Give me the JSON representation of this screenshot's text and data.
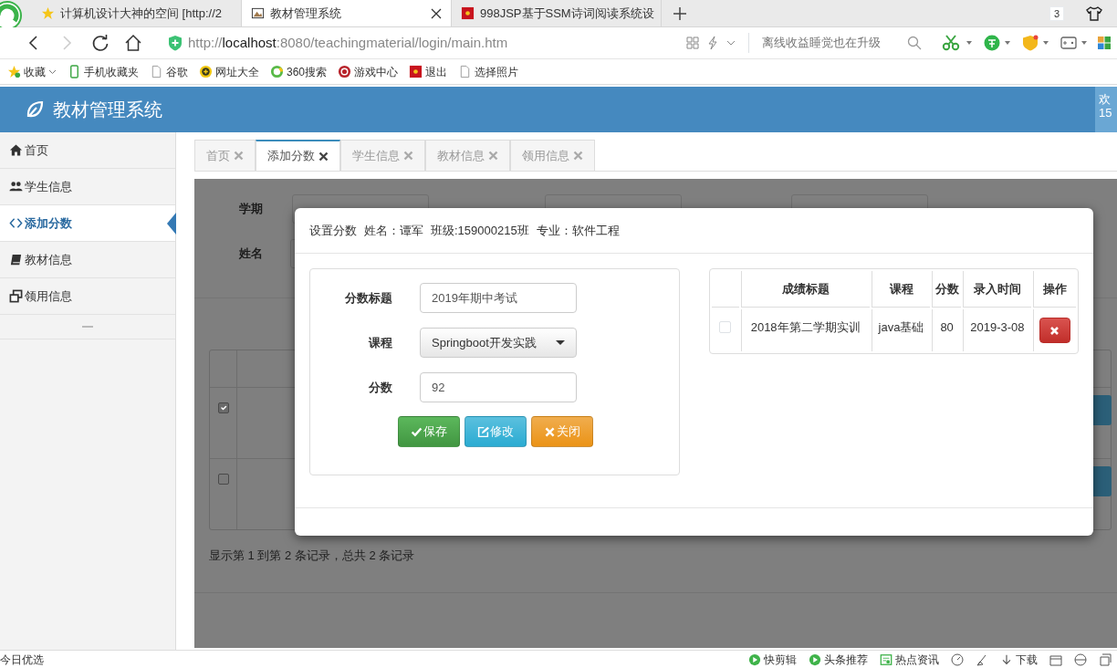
{
  "browser": {
    "tabs": [
      {
        "title": "计算机设计大神的空间 [http://2",
        "kind": "favorite",
        "selected": false
      },
      {
        "title": "教材管理系统",
        "kind": "app",
        "selected": true
      },
      {
        "title": "998JSP基于SSM诗词阅读系统设",
        "kind": "site",
        "selected": false
      }
    ],
    "tab_count": "3",
    "address": {
      "scheme": "http://",
      "host": "localhost",
      "path": ":8080/teachingmaterial/login/main.htm"
    },
    "search": {
      "placeholder": "离线收益睡觉也在升级"
    },
    "bookmarks": [
      {
        "label": "收藏",
        "kind": "favorites"
      },
      {
        "label": "手机收藏夹",
        "kind": "phone"
      },
      {
        "label": "谷歌",
        "kind": "page"
      },
      {
        "label": "网址大全",
        "kind": "portal"
      },
      {
        "label": "360搜索",
        "kind": "ring"
      },
      {
        "label": "游戏中心",
        "kind": "game"
      },
      {
        "label": "退出",
        "kind": "site"
      },
      {
        "label": "选择照片",
        "kind": "page"
      }
    ],
    "status_bar": {
      "left": "今日优选",
      "items": [
        {
          "label": "快剪辑",
          "kind": "play"
        },
        {
          "label": "头条推荐",
          "kind": "play"
        },
        {
          "label": "热点资讯",
          "kind": "news"
        },
        {
          "label": "下载",
          "kind": "download"
        }
      ]
    }
  },
  "app": {
    "title": "教材管理系统",
    "user": {
      "line_1": "欢",
      "line_2": "15"
    }
  },
  "sidebar": {
    "items": [
      {
        "label": "首页",
        "kind": "home",
        "selected": false
      },
      {
        "label": "学生信息",
        "kind": "users",
        "selected": false
      },
      {
        "label": "添加分数",
        "kind": "code",
        "selected": true
      },
      {
        "label": "教材信息",
        "kind": "book",
        "selected": false
      },
      {
        "label": "领用信息",
        "kind": "clone",
        "selected": false
      }
    ]
  },
  "tabs": [
    {
      "label": "首页",
      "selected": false
    },
    {
      "label": "添加分数",
      "selected": true
    },
    {
      "label": "学生信息",
      "selected": false
    },
    {
      "label": "教材信息",
      "selected": false
    },
    {
      "label": "领用信息",
      "selected": false
    }
  ],
  "filters": {
    "row_1": [
      "学期"
    ],
    "row_2": [
      "姓名"
    ]
  },
  "table": {
    "rows": [
      {
        "checked": true
      },
      {
        "checked": false
      }
    ]
  },
  "pagination": "显示第 1 到第 2 条记录，总共 2 条记录",
  "modal": {
    "title": "设置分数",
    "student": "姓名：谭军",
    "class": "班级:159000215班",
    "major": "专业：软件工程",
    "fields": [
      {
        "label": "分数标题",
        "value": "2019年期中考试",
        "kind": "text"
      },
      {
        "label": "课程",
        "value": "Springboot开发实践",
        "kind": "select"
      },
      {
        "label": "分数",
        "value": "92",
        "kind": "text"
      }
    ],
    "buttons": [
      {
        "label": "保存",
        "kind": "success"
      },
      {
        "label": "修改",
        "kind": "info"
      },
      {
        "label": "关闭",
        "kind": "warning"
      }
    ],
    "scores": {
      "columns": [
        "成绩标题",
        "课程",
        "分数",
        "录入时间",
        "操作"
      ],
      "rows": [
        {
          "checked": false,
          "cells": [
            "2018年第二学期实训",
            "java基础",
            "80",
            "2019-3-08"
          ]
        }
      ]
    }
  }
}
